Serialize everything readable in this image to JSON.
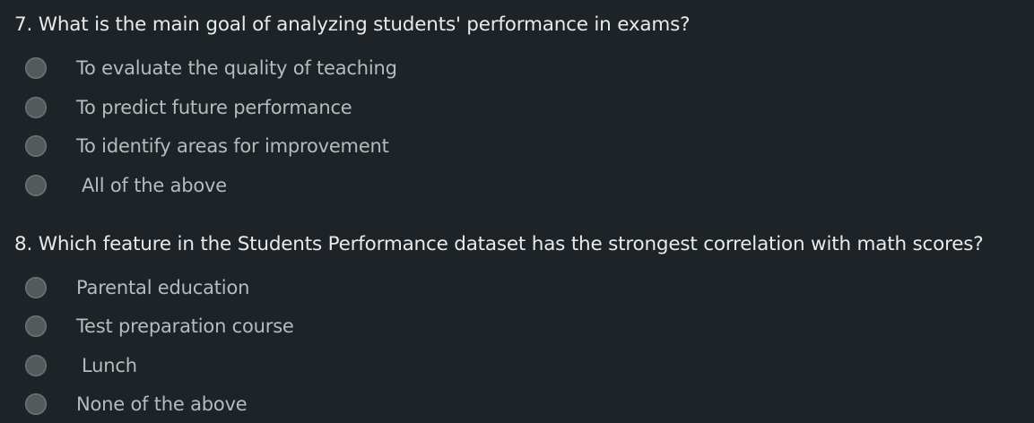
{
  "questions": [
    {
      "number": "7.",
      "text": "What is the main goal of analyzing students' performance in exams?",
      "options": [
        "To evaluate the quality of teaching",
        "To predict future performance",
        "To identify areas for improvement",
        "All of the above"
      ]
    },
    {
      "number": "8.",
      "text": "Which feature in the Students Performance dataset has the strongest correlation with math scores?",
      "options": [
        "Parental education",
        "Test preparation course",
        "Lunch",
        "None of the above"
      ]
    }
  ]
}
